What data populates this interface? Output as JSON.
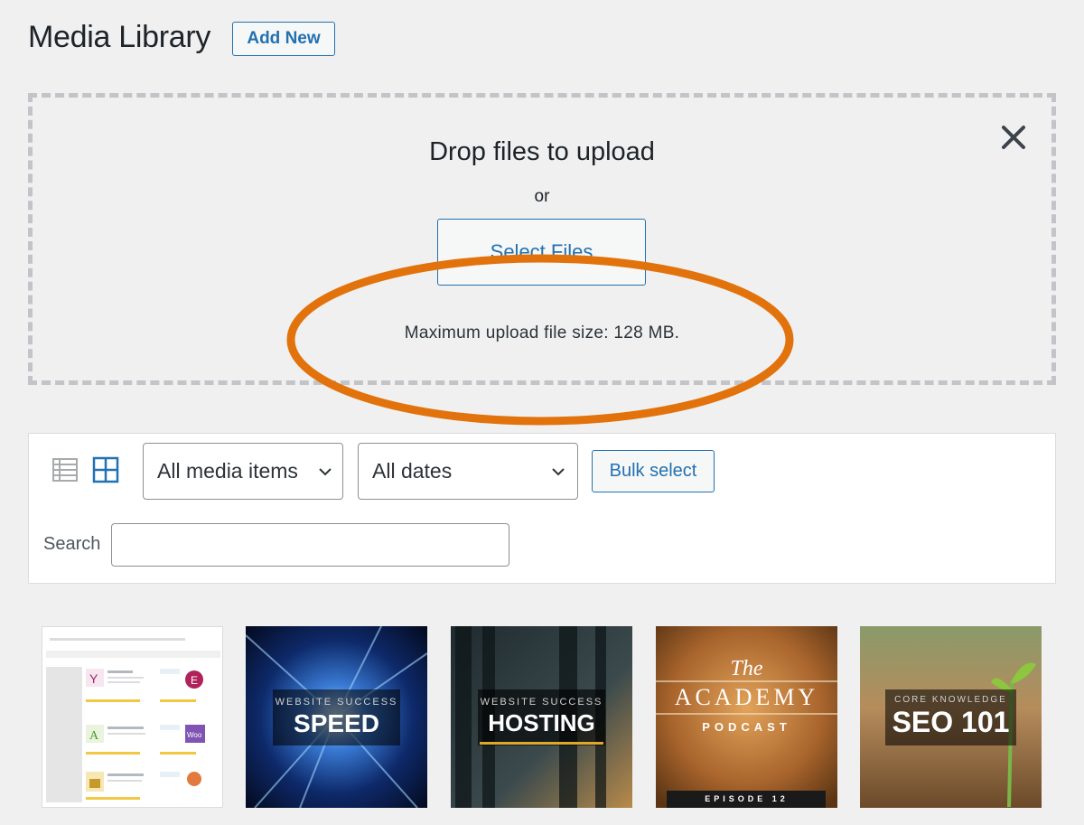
{
  "header": {
    "title": "Media Library",
    "add_new_label": "Add New"
  },
  "uploader": {
    "drop_title": "Drop files to upload",
    "or_text": "or",
    "select_files_label": "Select Files",
    "max_size_text": "Maximum upload file size: 128 MB.",
    "close_icon": "close-icon",
    "annotation_color": "#e2720b"
  },
  "toolbar": {
    "list_view_icon": "list-view-icon",
    "grid_view_icon": "grid-view-icon",
    "media_type_filter": "All media items",
    "date_filter": "All dates",
    "bulk_select_label": "Bulk select",
    "search_label": "Search",
    "search_value": ""
  },
  "media": [
    {
      "kind": "screenshot"
    },
    {
      "kind": "image",
      "line1": "WEBSITE SUCCESS",
      "line2": "SPEED"
    },
    {
      "kind": "image",
      "line1": "WEBSITE SUCCESS",
      "line2": "HOSTING"
    },
    {
      "kind": "image",
      "line1": "The",
      "line2": "ACADEMY",
      "line3": "PODCAST",
      "line4": "EPISODE 12"
    },
    {
      "kind": "image",
      "line1": "CORE KNOWLEDGE",
      "line2": "SEO 101"
    }
  ],
  "colors": {
    "accent": "#2271b1",
    "background": "#f0f0f1"
  }
}
